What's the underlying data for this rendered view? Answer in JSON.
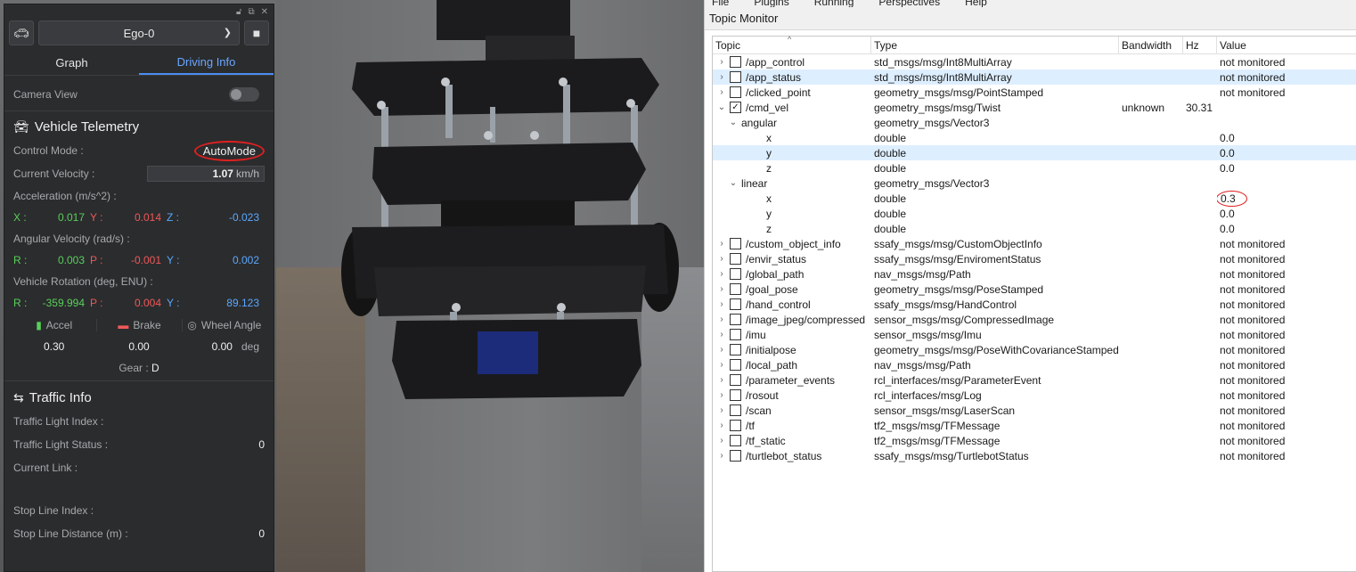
{
  "panel": {
    "vehicle": "Ego-0",
    "tabs": [
      "Graph",
      "Driving Info"
    ],
    "camera_view_label": "Camera View",
    "telemetry_title": "Vehicle Telemetry",
    "control_mode_label": "Control Mode :",
    "control_mode_value": "AutoMode",
    "velocity_label": "Current Velocity :",
    "velocity_value": "1.07",
    "velocity_unit": "km/h",
    "accel_label": "Acceleration (m/s^2) :",
    "accel": {
      "x_label": "X :",
      "x": "0.017",
      "y_label": "Y :",
      "y": "0.014",
      "z_label": "Z :",
      "z": "-0.023"
    },
    "angvel_label": "Angular Velocity (rad/s) :",
    "angvel": {
      "r_label": "R :",
      "r": "0.003",
      "p_label": "P :",
      "p": "-0.001",
      "y_label": "Y :",
      "y": "0.002"
    },
    "rotation_label": "Vehicle Rotation (deg, ENU) :",
    "rotation": {
      "r_label": "R :",
      "r": "-359.994",
      "p_label": "P :",
      "p": "0.004",
      "y_label": "Y :",
      "y": "89.123"
    },
    "accel_ctrl_label": "Accel",
    "brake_label": "Brake",
    "wheel_label": "Wheel Angle",
    "accel_ctrl_value": "0.30",
    "brake_value": "0.00",
    "wheel_value": "0.00",
    "wheel_unit": "deg",
    "gear_label": "Gear :",
    "gear_value": "D",
    "traffic_title": "Traffic Info",
    "tl_index_label": "Traffic Light Index :",
    "tl_status_label": "Traffic Light Status :",
    "tl_status_value": "0",
    "current_link_label": "Current Link :",
    "stop_line_index_label": "Stop Line Index :",
    "stop_line_distance_label": "Stop Line Distance (m) :",
    "stop_line_distance_value": "0"
  },
  "topic_monitor": {
    "menu": [
      "File",
      "Plugins",
      "Running",
      "Perspectives",
      "Help"
    ],
    "title": "Topic Monitor",
    "columns": [
      "Topic",
      "Type",
      "Bandwidth",
      "Hz",
      "Value"
    ],
    "rows": [
      {
        "topic": "/app_control",
        "type": "std_msgs/msg/Int8MultiArray",
        "bw": "",
        "hz": "",
        "value": "not monitored",
        "level": 0,
        "exp": ">",
        "cb": true,
        "checked": false
      },
      {
        "topic": "/app_status",
        "type": "std_msgs/msg/Int8MultiArray",
        "bw": "",
        "hz": "",
        "value": "not monitored",
        "level": 0,
        "exp": ">",
        "cb": true,
        "checked": false,
        "selected": true
      },
      {
        "topic": "/clicked_point",
        "type": "geometry_msgs/msg/PointStamped",
        "bw": "",
        "hz": "",
        "value": "not monitored",
        "level": 0,
        "exp": ">",
        "cb": true,
        "checked": false
      },
      {
        "topic": "/cmd_vel",
        "type": "geometry_msgs/msg/Twist",
        "bw": "unknown",
        "hz": "30.31",
        "value": "",
        "level": 0,
        "exp": "v",
        "cb": true,
        "checked": true
      },
      {
        "topic": "angular",
        "type": "geometry_msgs/Vector3",
        "bw": "",
        "hz": "",
        "value": "",
        "level": 1,
        "exp": "v",
        "cb": false
      },
      {
        "topic": "x",
        "type": "double",
        "bw": "",
        "hz": "",
        "value": "0.0",
        "level": 2,
        "exp": "",
        "cb": false
      },
      {
        "topic": "y",
        "type": "double",
        "bw": "",
        "hz": "",
        "value": "0.0",
        "level": 2,
        "exp": "",
        "cb": false,
        "selected": true
      },
      {
        "topic": "z",
        "type": "double",
        "bw": "",
        "hz": "",
        "value": "0.0",
        "level": 2,
        "exp": "",
        "cb": false
      },
      {
        "topic": "linear",
        "type": "geometry_msgs/Vector3",
        "bw": "",
        "hz": "",
        "value": "",
        "level": 1,
        "exp": "v",
        "cb": false
      },
      {
        "topic": "x",
        "type": "double",
        "bw": "",
        "hz": "",
        "value": "0.3",
        "level": 2,
        "exp": "",
        "cb": false,
        "circled": true
      },
      {
        "topic": "y",
        "type": "double",
        "bw": "",
        "hz": "",
        "value": "0.0",
        "level": 2,
        "exp": "",
        "cb": false
      },
      {
        "topic": "z",
        "type": "double",
        "bw": "",
        "hz": "",
        "value": "0.0",
        "level": 2,
        "exp": "",
        "cb": false
      },
      {
        "topic": "/custom_object_info",
        "type": "ssafy_msgs/msg/CustomObjectInfo",
        "bw": "",
        "hz": "",
        "value": "not monitored",
        "level": 0,
        "exp": ">",
        "cb": true,
        "checked": false
      },
      {
        "topic": "/envir_status",
        "type": "ssafy_msgs/msg/EnviromentStatus",
        "bw": "",
        "hz": "",
        "value": "not monitored",
        "level": 0,
        "exp": ">",
        "cb": true,
        "checked": false
      },
      {
        "topic": "/global_path",
        "type": "nav_msgs/msg/Path",
        "bw": "",
        "hz": "",
        "value": "not monitored",
        "level": 0,
        "exp": ">",
        "cb": true,
        "checked": false
      },
      {
        "topic": "/goal_pose",
        "type": "geometry_msgs/msg/PoseStamped",
        "bw": "",
        "hz": "",
        "value": "not monitored",
        "level": 0,
        "exp": ">",
        "cb": true,
        "checked": false
      },
      {
        "topic": "/hand_control",
        "type": "ssafy_msgs/msg/HandControl",
        "bw": "",
        "hz": "",
        "value": "not monitored",
        "level": 0,
        "exp": ">",
        "cb": true,
        "checked": false
      },
      {
        "topic": "/image_jpeg/compressed",
        "type": "sensor_msgs/msg/CompressedImage",
        "bw": "",
        "hz": "",
        "value": "not monitored",
        "level": 0,
        "exp": ">",
        "cb": true,
        "checked": false
      },
      {
        "topic": "/imu",
        "type": "sensor_msgs/msg/Imu",
        "bw": "",
        "hz": "",
        "value": "not monitored",
        "level": 0,
        "exp": ">",
        "cb": true,
        "checked": false
      },
      {
        "topic": "/initialpose",
        "type": "geometry_msgs/msg/PoseWithCovarianceStamped",
        "bw": "",
        "hz": "",
        "value": "not monitored",
        "level": 0,
        "exp": ">",
        "cb": true,
        "checked": false
      },
      {
        "topic": "/local_path",
        "type": "nav_msgs/msg/Path",
        "bw": "",
        "hz": "",
        "value": "not monitored",
        "level": 0,
        "exp": ">",
        "cb": true,
        "checked": false
      },
      {
        "topic": "/parameter_events",
        "type": "rcl_interfaces/msg/ParameterEvent",
        "bw": "",
        "hz": "",
        "value": "not monitored",
        "level": 0,
        "exp": ">",
        "cb": true,
        "checked": false
      },
      {
        "topic": "/rosout",
        "type": "rcl_interfaces/msg/Log",
        "bw": "",
        "hz": "",
        "value": "not monitored",
        "level": 0,
        "exp": ">",
        "cb": true,
        "checked": false
      },
      {
        "topic": "/scan",
        "type": "sensor_msgs/msg/LaserScan",
        "bw": "",
        "hz": "",
        "value": "not monitored",
        "level": 0,
        "exp": ">",
        "cb": true,
        "checked": false
      },
      {
        "topic": "/tf",
        "type": "tf2_msgs/msg/TFMessage",
        "bw": "",
        "hz": "",
        "value": "not monitored",
        "level": 0,
        "exp": ">",
        "cb": true,
        "checked": false
      },
      {
        "topic": "/tf_static",
        "type": "tf2_msgs/msg/TFMessage",
        "bw": "",
        "hz": "",
        "value": "not monitored",
        "level": 0,
        "exp": ">",
        "cb": true,
        "checked": false
      },
      {
        "topic": "/turtlebot_status",
        "type": "ssafy_msgs/msg/TurtlebotStatus",
        "bw": "",
        "hz": "",
        "value": "not monitored",
        "level": 0,
        "exp": ">",
        "cb": true,
        "checked": false
      }
    ]
  }
}
